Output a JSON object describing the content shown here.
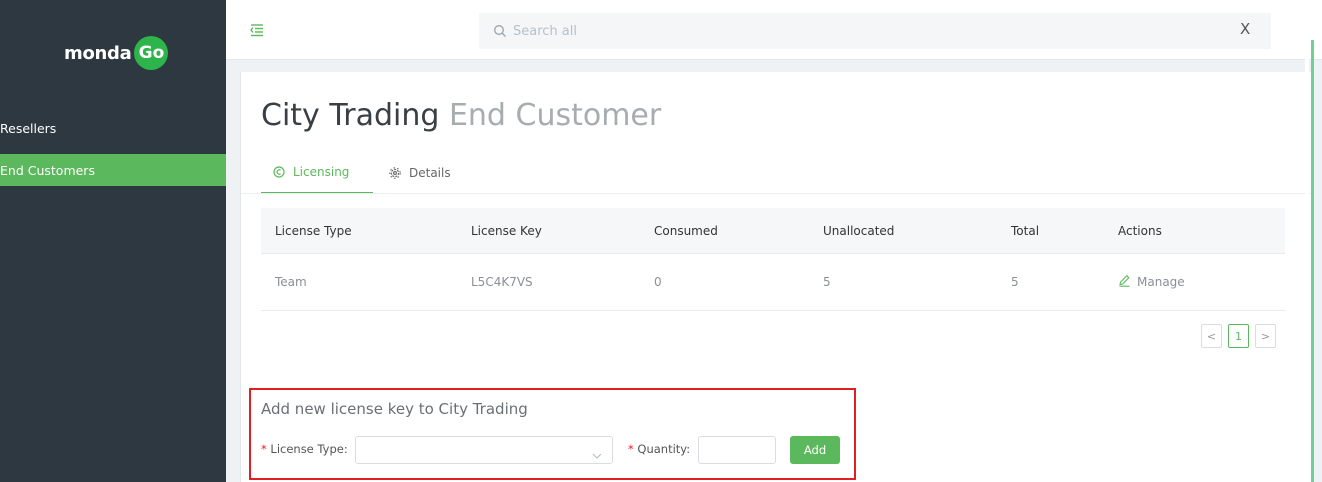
{
  "brand": {
    "name": "monda",
    "badge": "Go"
  },
  "sidebar": {
    "items": [
      {
        "label": "Resellers",
        "active": false
      },
      {
        "label": "End Customers",
        "active": true
      }
    ]
  },
  "topbar": {
    "search_placeholder": "Search all",
    "close_label": "X"
  },
  "page": {
    "title_main": "City Trading",
    "title_sub": "End Customer"
  },
  "tabs": [
    {
      "label": "Licensing",
      "icon": "license-icon",
      "active": true
    },
    {
      "label": "Details",
      "icon": "gear-icon",
      "active": false
    }
  ],
  "table": {
    "headers": [
      "License Type",
      "License Key",
      "Consumed",
      "Unallocated",
      "Total",
      "Actions"
    ],
    "rows": [
      {
        "type": "Team",
        "key": "L5C4K7VS",
        "consumed": "0",
        "unallocated": "5",
        "total": "5",
        "action": "Manage"
      }
    ]
  },
  "pagination": {
    "prev": "<",
    "current": "1",
    "next": ">"
  },
  "add_form": {
    "title": "Add new license key to City Trading",
    "license_type_label": "License Type",
    "quantity_label": "Quantity",
    "required_mark": "*",
    "license_type_value": "",
    "quantity_value": "",
    "add_label": "Add"
  },
  "colors": {
    "accent": "#5cb85c",
    "sidebar_bg": "#2e3840",
    "highlight_border": "#e02020"
  }
}
